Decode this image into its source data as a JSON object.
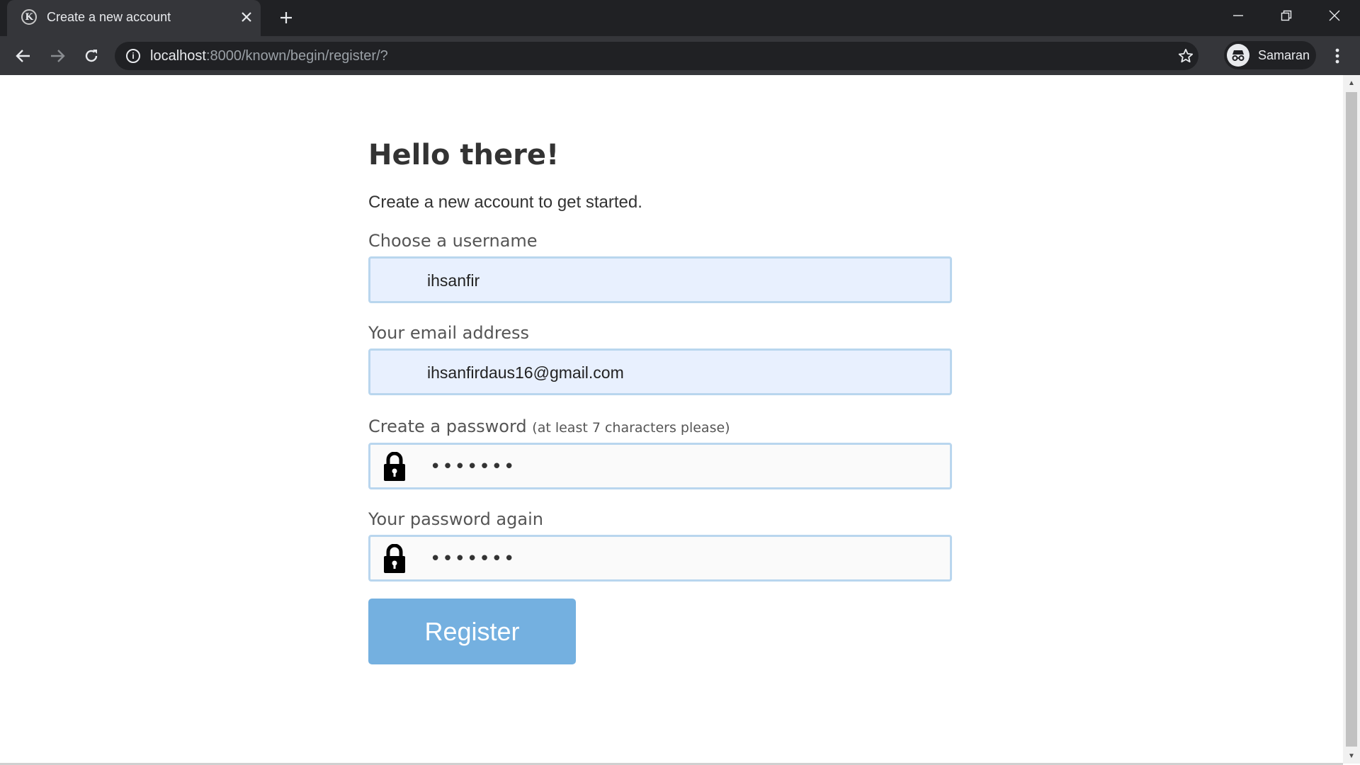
{
  "browser": {
    "tab_title": "Create a new account",
    "tab_favicon_letter": "K",
    "url_host": "localhost",
    "url_rest": ":8000/known/begin/register/?",
    "profile_name": "Samaran"
  },
  "page": {
    "headline": "Hello there!",
    "subtitle": "Create a new account to get started.",
    "username_label": "Choose a username",
    "username_value": "ihsanfir",
    "email_label": "Your email address",
    "email_value": "ihsanfirdaus16@gmail.com",
    "password_label": "Create a password",
    "password_hint": "(at least 7 characters please)",
    "password_value": "•••••••",
    "password_again_label": "Your password again",
    "password_again_value": "•••••••",
    "register_label": "Register"
  },
  "colors": {
    "chrome_dark": "#202124",
    "tab_active": "#35363a",
    "field_border": "#b9d6ee",
    "autofill_bg": "#e8f0fe",
    "button_bg": "#74b0e0"
  },
  "icons": {
    "tab_favicon": "known-logo-icon",
    "tab_close": "close-icon",
    "new_tab": "plus-icon",
    "back": "back-arrow-icon",
    "forward": "forward-arrow-icon",
    "reload": "reload-icon",
    "site_info": "info-icon",
    "bookmark": "star-icon",
    "profile": "incognito-icon",
    "menu": "kebab-menu-icon",
    "password_fields": "lock-icon"
  }
}
